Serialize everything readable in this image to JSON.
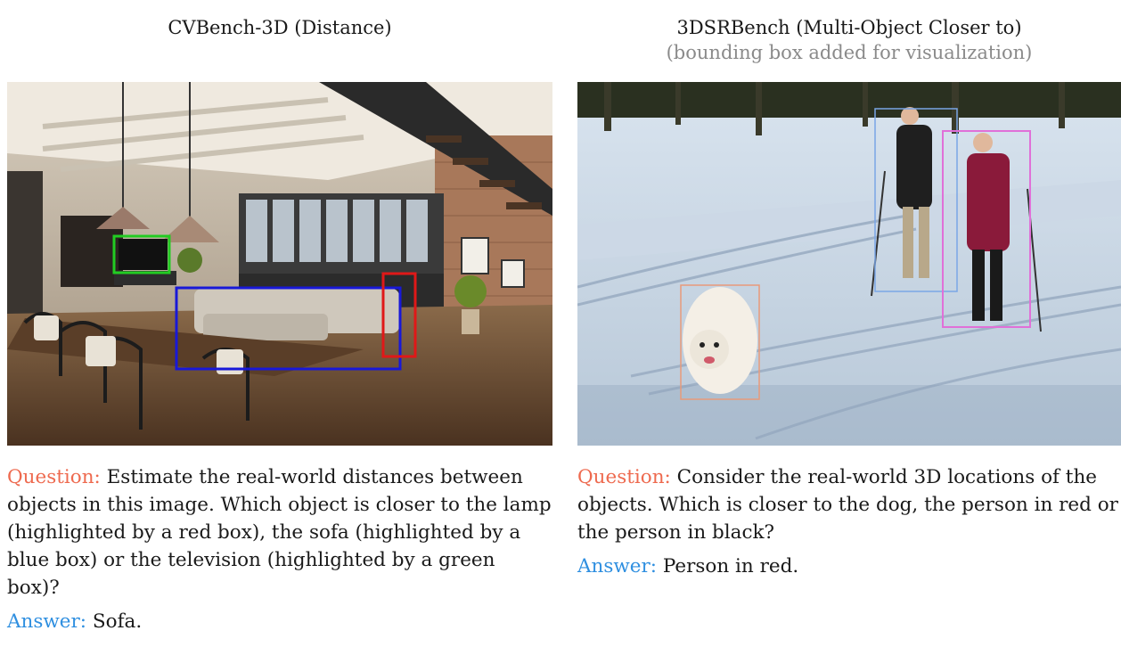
{
  "left": {
    "title": "CVBench-3D (Distance)",
    "image_alt": "Loft living room with staircase, sofa, lamp and television",
    "question_label": "Question:",
    "question_text": " Estimate the real-world distances between objects in this image. Which object is closer to the lamp (highlighted by a red box), the sofa (highlighted by a blue box) or the television (highlighted by a green box)?",
    "answer_label": "Answer:",
    "answer_text": " Sofa.",
    "box_colors": {
      "lamp": "#e01818",
      "sofa": "#1818d8",
      "television": "#22cc22"
    }
  },
  "right": {
    "title": "3DSRBench (Multi-Object Closer to)",
    "subtitle": "(bounding box added for visualization)",
    "image_alt": "Two cross-country skiers in snow with a white dog",
    "question_label": "Question:",
    "question_text": " Consider the real-world 3D locations of the objects. Which is closer to the dog, the person in red or the person in black?",
    "answer_label": "Answer:",
    "answer_text": " Person in red.",
    "box_colors": {
      "person_black": "#7aa6e6",
      "person_red": "#e070d8",
      "dog": "#e89a7a"
    }
  },
  "colors": {
    "question_label": "#ee6a4f",
    "answer_label": "#2f8fe0",
    "subtitle": "#8a8a8a"
  }
}
